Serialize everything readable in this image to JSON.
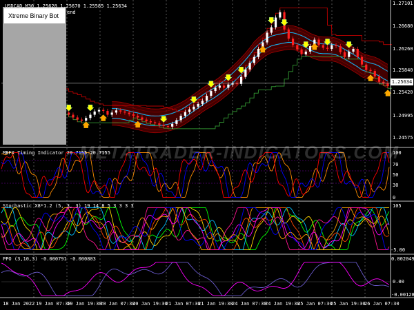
{
  "chart_data": [
    {
      "type": "line",
      "title": "USDCAD,M30  1.25628 1.25670 1.25585 1.25634",
      "yticks": [
        "1.27101",
        "1.26680",
        "1.26260",
        "1.25840",
        "1.25420",
        "1.24995",
        "1.24575"
      ],
      "ylim": [
        1.2447,
        1.2715
      ],
      "last_price": "1.25634",
      "series": [
        {
          "name": "close",
          "values": [
            1.2566,
            1.2563,
            1.2558,
            1.2552,
            1.2545,
            1.254,
            1.2537,
            1.2534,
            1.253,
            1.2526,
            1.2522,
            1.2519,
            1.2517,
            1.2512,
            1.2509,
            1.2505,
            1.25,
            1.2496,
            1.2494,
            1.2499,
            1.2505,
            1.2511,
            1.2514,
            1.2512,
            1.2505,
            1.2509,
            1.2513,
            1.2511,
            1.2509,
            1.2506,
            1.2503,
            1.25,
            1.2496,
            1.2493,
            1.2491,
            1.2489,
            1.2486,
            1.2484,
            1.2483,
            1.2488,
            1.2495,
            1.2503,
            1.251,
            1.2515,
            1.252,
            1.2525,
            1.2531,
            1.254,
            1.2549,
            1.2555,
            1.2559,
            1.2555,
            1.2561,
            1.2563,
            1.2562,
            1.2575,
            1.2589,
            1.2601,
            1.2612,
            1.2627,
            1.2639,
            1.2657,
            1.2667,
            1.2685,
            1.2695,
            1.2663,
            1.2646,
            1.2634,
            1.2626,
            1.2617,
            1.2622,
            1.2632,
            1.2644,
            1.2634,
            1.2629,
            1.2627,
            1.2634,
            1.2632,
            1.2621,
            1.2612,
            1.2622,
            1.2627,
            1.2612,
            1.2598,
            1.2588,
            1.2586,
            1.2576,
            1.2566,
            1.2563,
            1.2558
          ]
        }
      ]
    },
    {
      "type": "line",
      "title": "MBFX Timing Indicator 20.7155 20.7155",
      "yticks": [
        "100",
        "70",
        "50",
        "30",
        "0"
      ],
      "ylim": [
        0,
        100
      ]
    },
    {
      "type": "line",
      "title": "Stochastic X8*1.2 (5, 3, 3) 19 14 8 5 3 3 3 3",
      "yticks": [
        "105",
        "-5.00"
      ],
      "ylim": [
        -5,
        105
      ]
    },
    {
      "type": "line",
      "title": "PPO (3,10,3) -0.000791 -0.000803",
      "yticks": [
        "0.002049",
        "0.00",
        "-0.001282"
      ],
      "ylim": [
        -0.001282,
        0.002049
      ]
    }
  ],
  "xaxis": {
    "labels": [
      "18 Jan 2022",
      "19 Jan 07:30",
      "19 Jan 19:30",
      "20 Jan 07:30",
      "20 Jan 19:30",
      "21 Jan 07:30",
      "21 Jan 19:30",
      "24 Jan 07:30",
      "24 Jan 19:30",
      "25 Jan 07:30",
      "25 Jan 19:30",
      "26 Jan 07:30"
    ]
  },
  "overlay": {
    "label": "Xtreme Binary Bot",
    "hidden_suffix": "end"
  },
  "watermark": "METATRADER-INDICATORS.COM",
  "colors": {
    "background": "#000000",
    "bull_candle": "#ffffff",
    "bear_candle": "#ff2020",
    "channel": "#8b0000",
    "band_cyan": "#00bfff",
    "band_green": "#2e8b2e",
    "arrow_up": "#ffa500",
    "arrow_down": "#ffff00"
  }
}
